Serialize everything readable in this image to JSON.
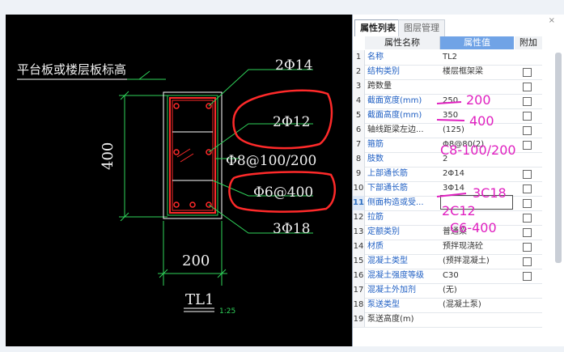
{
  "drawing": {
    "slab_label": "平台板或楼层板标高",
    "top_rebar": "2Φ14",
    "side_rebar": "2Φ12",
    "stirrup": "Φ8@100/200",
    "tie": "Φ6@400",
    "bottom_rebar": "3Φ18",
    "height_dim": "400",
    "width_dim": "200",
    "beam_name": "TL1",
    "scale": "1:25"
  },
  "panel": {
    "tabs": [
      "属性列表",
      "图层管理"
    ],
    "close_label": "×",
    "headers": {
      "name": "属性名称",
      "value": "属性值",
      "add": "附加"
    },
    "rows": [
      {
        "n": "1",
        "name": "名称",
        "value": "TL2",
        "check": false
      },
      {
        "n": "2",
        "name": "结构类别",
        "value": "楼层框架梁",
        "check": true
      },
      {
        "n": "3",
        "name": "跨数量",
        "value": "",
        "check": true
      },
      {
        "n": "4",
        "name": "截面宽度(mm)",
        "value": "250",
        "check": true
      },
      {
        "n": "5",
        "name": "截面高度(mm)",
        "value": "350",
        "check": true
      },
      {
        "n": "6",
        "name": "轴线距梁左边...",
        "value": "(125)",
        "check": true
      },
      {
        "n": "7",
        "name": "箍筋",
        "value": "Φ8@80(2)",
        "check": true
      },
      {
        "n": "8",
        "name": "肢数",
        "value": "2",
        "check": false
      },
      {
        "n": "9",
        "name": "上部通长筋",
        "value": "2Φ14",
        "check": true
      },
      {
        "n": "10",
        "name": "下部通长筋",
        "value": "3Φ14",
        "check": true
      },
      {
        "n": "11",
        "name": "侧面构造或受...",
        "value": "",
        "check": true
      },
      {
        "n": "12",
        "name": "拉筋",
        "value": "",
        "check": true
      },
      {
        "n": "13",
        "name": "定额类别",
        "value": "普通梁",
        "check": true
      },
      {
        "n": "14",
        "name": "材质",
        "value": "预拌现浇砼",
        "check": true
      },
      {
        "n": "15",
        "name": "混凝土类型",
        "value": "(预拌混凝土)",
        "check": true
      },
      {
        "n": "16",
        "name": "混凝土强度等级",
        "value": "C30",
        "check": true
      },
      {
        "n": "17",
        "name": "混凝土外加剂",
        "value": "(无)",
        "check": false
      },
      {
        "n": "18",
        "name": "泵送类型",
        "value": "(混凝土泵)",
        "check": false
      },
      {
        "n": "19",
        "name": "泵送高度(m)",
        "value": "",
        "check": false
      }
    ],
    "annotations": {
      "width": "200",
      "height": "400",
      "stirrup": "C8-100/200",
      "bottom": "3C18",
      "side": "2C12",
      "tie": "C6-400"
    }
  },
  "colors": {
    "blue_name": "#1f5fc3",
    "annotation": "#e020c0",
    "cad_bg": "#000000",
    "cad_green": "#2fd35a",
    "cad_red": "#ff2a2a",
    "header_blue": "#70a3e6"
  }
}
